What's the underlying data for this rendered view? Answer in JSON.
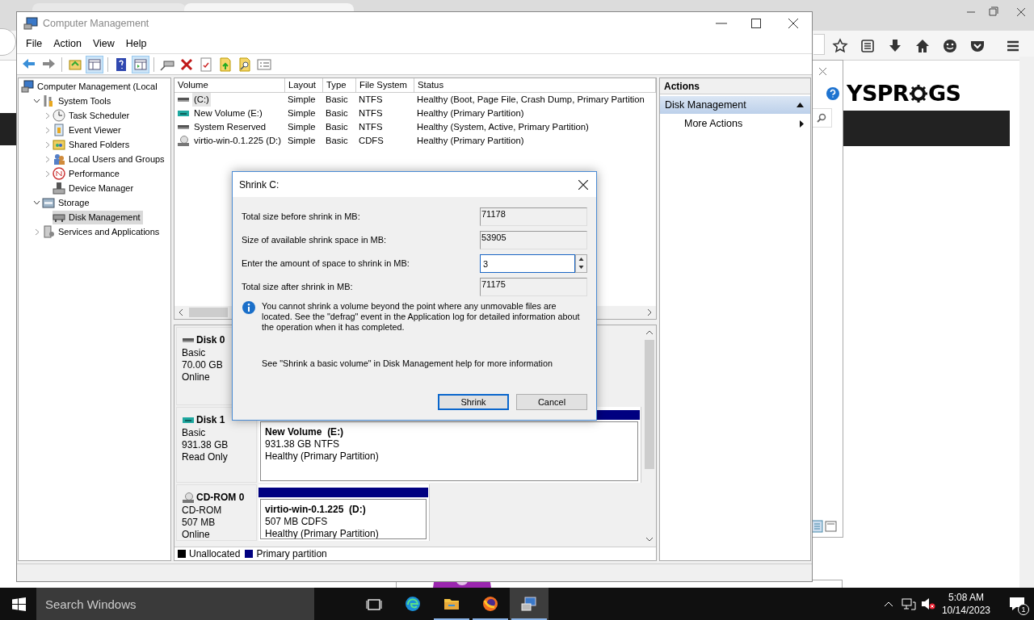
{
  "browser": {
    "logo_left": "YSPR",
    "logo_right": "GS"
  },
  "window": {
    "title": "Computer Management"
  },
  "menu": [
    "File",
    "Action",
    "View",
    "Help"
  ],
  "toolbar": [
    {
      "kind": "back",
      "pressed": false
    },
    {
      "kind": "forward",
      "pressed": false
    },
    {
      "kind": "up",
      "pressed": false
    },
    {
      "kind": "tree",
      "pressed": true
    },
    {
      "kind": "help",
      "pressed": false
    },
    {
      "kind": "pane",
      "pressed": true
    },
    {
      "kind": "connect",
      "pressed": false
    },
    {
      "kind": "delete",
      "pressed": false
    },
    {
      "kind": "properties",
      "pressed": false
    },
    {
      "kind": "export",
      "pressed": false
    },
    {
      "kind": "find",
      "pressed": false
    },
    {
      "kind": "list",
      "pressed": false
    }
  ],
  "tree": [
    {
      "label": "Computer Management (Local",
      "kind": "computer",
      "selected": false,
      "children": [
        {
          "label": "System Tools",
          "kind": "tools",
          "expanded": true,
          "selected": false,
          "children": [
            {
              "label": "Task Scheduler",
              "kind": "clock",
              "expanded": false,
              "selected": false
            },
            {
              "label": "Event Viewer",
              "kind": "log",
              "expanded": false,
              "selected": false
            },
            {
              "label": "Shared Folders",
              "kind": "folder",
              "expanded": false,
              "selected": false
            },
            {
              "label": "Local Users and Groups",
              "kind": "users",
              "expanded": false,
              "selected": false
            },
            {
              "label": "Performance",
              "kind": "perf",
              "expanded": false,
              "selected": false
            },
            {
              "label": "Device Manager",
              "kind": "device",
              "selected": false
            }
          ]
        },
        {
          "label": "Storage",
          "kind": "storage",
          "expanded": true,
          "selected": false,
          "children": [
            {
              "label": "Disk Management",
              "kind": "disk",
              "selected": true
            }
          ]
        },
        {
          "label": "Services and Applications",
          "kind": "services",
          "expanded": false,
          "selected": false
        }
      ]
    }
  ],
  "volumes": {
    "columns": [
      "Volume",
      "Layout",
      "Type",
      "File System",
      "Status"
    ],
    "rows": [
      {
        "kind": "hdd",
        "selected": true,
        "cells": [
          "(C:)",
          "Simple",
          "Basic",
          "NTFS",
          "Healthy (Boot, Page File, Crash Dump, Primary Partition"
        ]
      },
      {
        "kind": "removable",
        "selected": false,
        "cells": [
          "New Volume (E:)",
          "Simple",
          "Basic",
          "NTFS",
          "Healthy (Primary Partition)"
        ]
      },
      {
        "kind": "hdd",
        "selected": false,
        "cells": [
          "System Reserved",
          "Simple",
          "Basic",
          "NTFS",
          "Healthy (System, Active, Primary Partition)"
        ]
      },
      {
        "kind": "cdrom",
        "selected": false,
        "cells": [
          "virtio-win-0.1.225 (D:)",
          "Simple",
          "Basic",
          "CDFS",
          "Healthy (Primary Partition)"
        ]
      }
    ]
  },
  "disks": [
    {
      "name": "Disk 0",
      "kind": "hdd",
      "lines": [
        "Basic",
        "70.00 GB",
        "Online"
      ]
    },
    {
      "name": "Disk 1",
      "kind": "removable",
      "lines": [
        "Basic",
        "931.38 GB",
        "Read Only"
      ],
      "partitions": [
        {
          "title": "New Volume  (E:)",
          "lines": [
            "931.38 GB NTFS",
            "Healthy (Primary Partition)"
          ]
        }
      ]
    },
    {
      "name": "CD-ROM 0",
      "kind": "cdrom",
      "lines": [
        "CD-ROM",
        "507 MB",
        "Online"
      ],
      "partitions": [
        {
          "title": "virtio-win-0.1.225  (D:)",
          "lines": [
            "507 MB CDFS",
            "Healthy (Primary Partition)"
          ]
        }
      ]
    }
  ],
  "legend": [
    {
      "label": "Unallocated",
      "color": "#000000"
    },
    {
      "label": "Primary partition",
      "color": "#000080"
    }
  ],
  "actions": {
    "title": "Actions",
    "items": [
      {
        "label": "Disk Management",
        "kind": "section"
      },
      {
        "label": "More Actions",
        "kind": "item"
      }
    ]
  },
  "dialog": {
    "title": "Shrink C:",
    "fields": [
      {
        "label": "Total size before shrink in MB:",
        "value": "71178",
        "editable": false
      },
      {
        "label": "Size of available shrink space in MB:",
        "value": "53905",
        "editable": false
      },
      {
        "label": "Enter the amount of space to shrink in MB:",
        "value": "3",
        "editable": true
      },
      {
        "label": "Total size after shrink in MB:",
        "value": "71175",
        "editable": false
      }
    ],
    "info": "You cannot shrink a volume beyond the point where any unmovable files are located. See the \"defrag\" event in the Application log for detailed information about the operation when it has completed.",
    "help": "See \"Shrink a basic volume\" in Disk Management help for more information",
    "buttons": [
      {
        "label": "Shrink",
        "default": true
      },
      {
        "label": "Cancel",
        "default": false
      }
    ]
  },
  "taskbar": {
    "search_placeholder": "Search Windows",
    "apps": [
      {
        "kind": "taskview",
        "running": false,
        "selected": false
      },
      {
        "kind": "edge",
        "running": false,
        "selected": false
      },
      {
        "kind": "explorer",
        "running": true,
        "selected": false
      },
      {
        "kind": "firefox",
        "running": true,
        "selected": false
      },
      {
        "kind": "computer",
        "running": true,
        "selected": true
      }
    ],
    "time": "5:08 AM",
    "date": "10/14/2023",
    "notifications": "1"
  }
}
